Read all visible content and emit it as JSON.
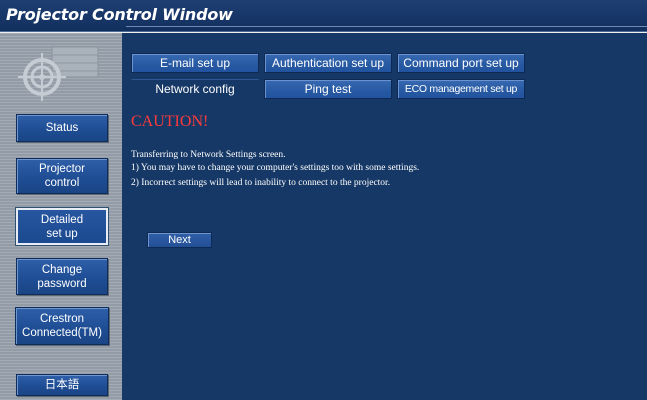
{
  "window": {
    "title": "Projector Control Window"
  },
  "sidebar": {
    "logo_icon": "crosshair-target-icon",
    "items": [
      {
        "label": "Status",
        "active": false
      },
      {
        "label": "Projector\ncontrol",
        "active": false
      },
      {
        "label": "Detailed\nset up",
        "active": true
      },
      {
        "label": "Change\npassword",
        "active": false
      },
      {
        "label": "Crestron\nConnected(TM)",
        "active": false
      },
      {
        "label": "日本語",
        "active": false
      }
    ]
  },
  "tabs": {
    "row1": [
      {
        "label": "E-mail set up"
      },
      {
        "label": "Authentication set up"
      },
      {
        "label": "Command port set up"
      }
    ],
    "row2": [
      {
        "label": "Network config",
        "active": true
      },
      {
        "label": "Ping test"
      },
      {
        "label": "ECO management set up"
      }
    ]
  },
  "content": {
    "caution": "CAUTION!",
    "lines": [
      "Transferring to Network Settings screen.",
      "1)  You may have to change your computer's settings too with some settings.",
      "2)  Incorrect settings will lead to inability to connect to the projector."
    ],
    "next_label": "Next"
  },
  "colors": {
    "title_bar": "#173567",
    "main_bg": "#163866",
    "button": "#1f4e95",
    "caution": "#ff3b3b",
    "sidebar_bg": "#9aa3ad"
  }
}
